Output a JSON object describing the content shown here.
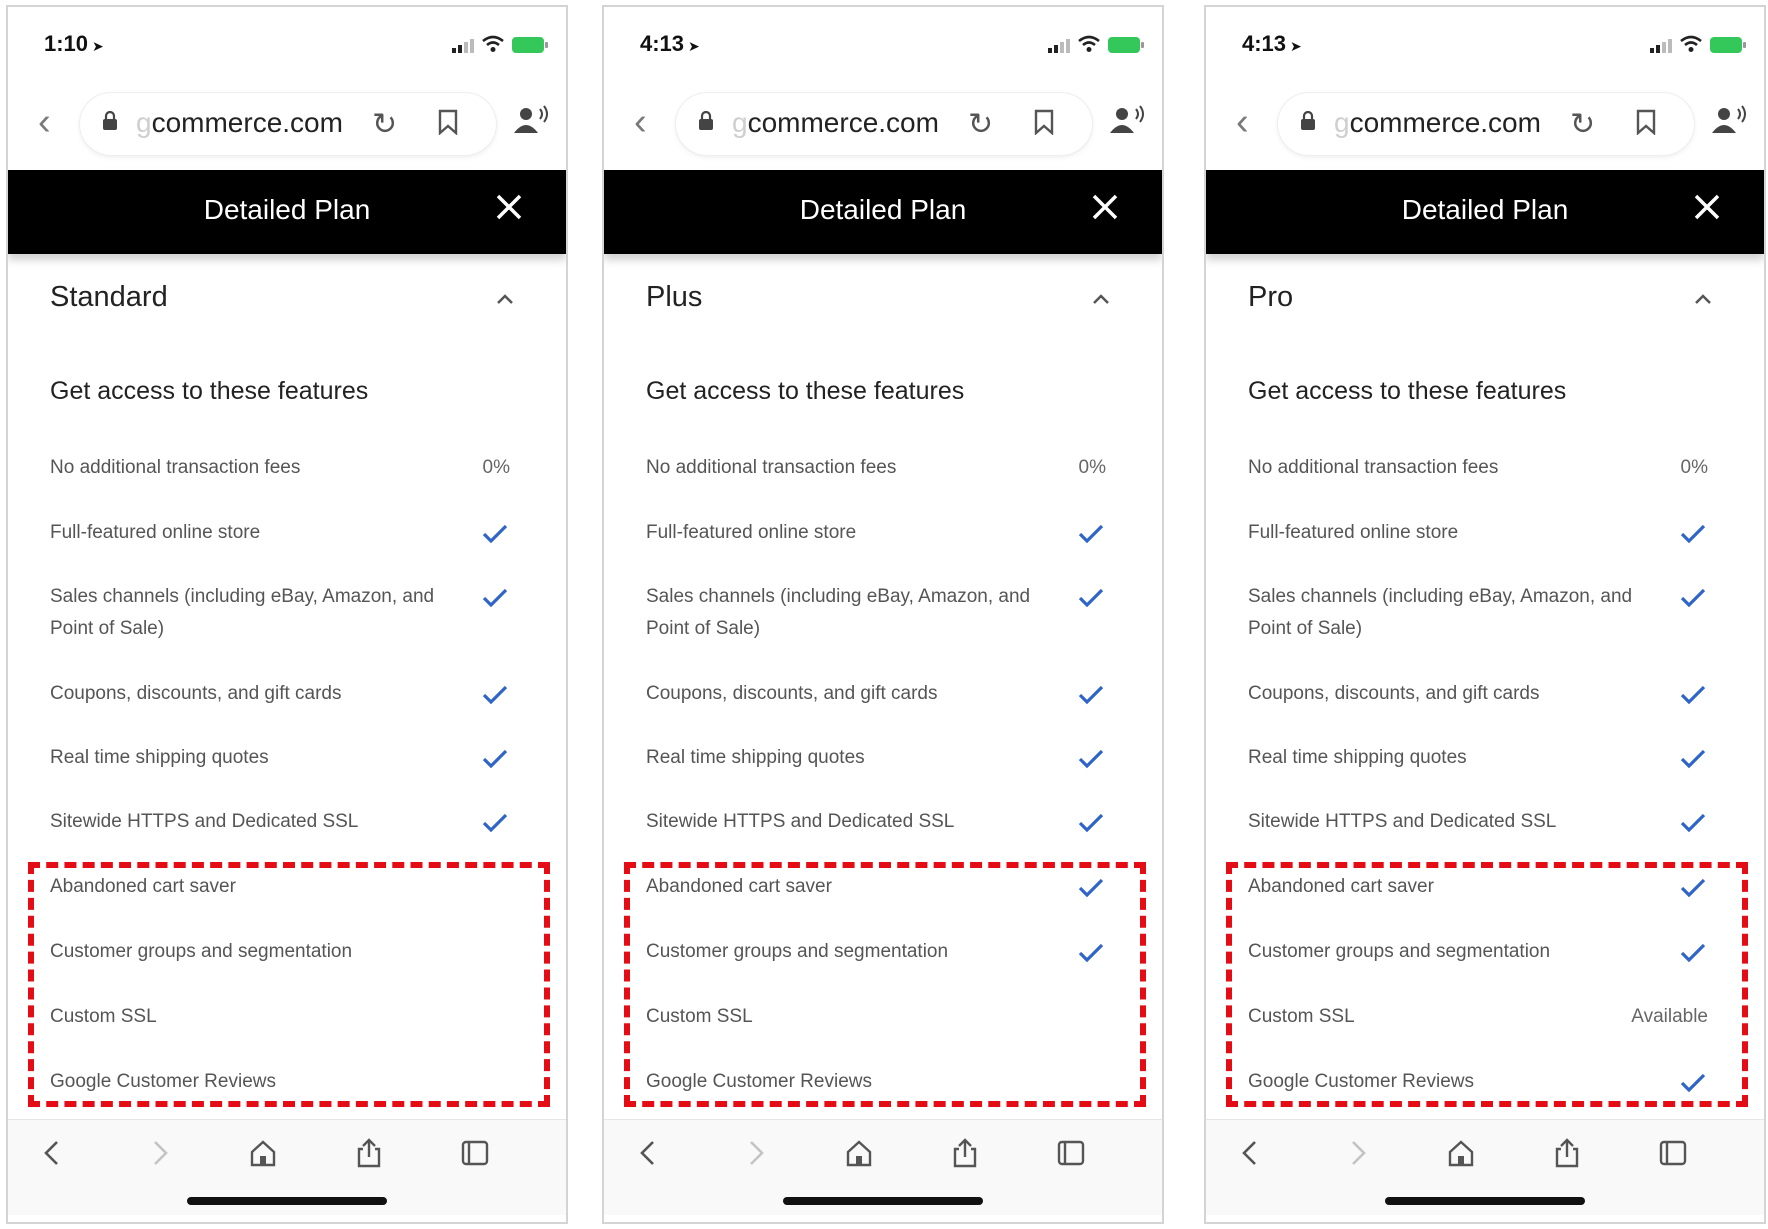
{
  "colors": {
    "check": "#2f64c9",
    "highlight": "#e40d16",
    "header_bg": "#000000"
  },
  "browser": {
    "url_faded": "g",
    "url_rest": "commerce.com"
  },
  "modal": {
    "title": "Detailed Plan",
    "close_icon": "close-icon"
  },
  "section_title": "Get access to these features",
  "features": [
    "No additional transaction fees",
    "Full-featured online store",
    "Sales channels (including eBay, Amazon, and Point of Sale)",
    "Coupons, discounts, and gift cards",
    "Real time shipping quotes",
    "Sitewide HTTPS and Dedicated SSL",
    "Abandoned cart saver",
    "Customer groups and segmentation",
    "Custom SSL",
    "Google Customer Reviews"
  ],
  "phones": [
    {
      "time": "1:10",
      "plan": "Standard",
      "values": [
        "0%",
        "check",
        "check",
        "check",
        "check",
        "check",
        "",
        "",
        "",
        ""
      ]
    },
    {
      "time": "4:13",
      "plan": "Plus",
      "values": [
        "0%",
        "check",
        "check",
        "check",
        "check",
        "check",
        "check",
        "check",
        "",
        ""
      ]
    },
    {
      "time": "4:13",
      "plan": "Pro",
      "values": [
        "0%",
        "check",
        "check",
        "check",
        "check",
        "check",
        "check",
        "check",
        "Available",
        "check"
      ]
    }
  ]
}
